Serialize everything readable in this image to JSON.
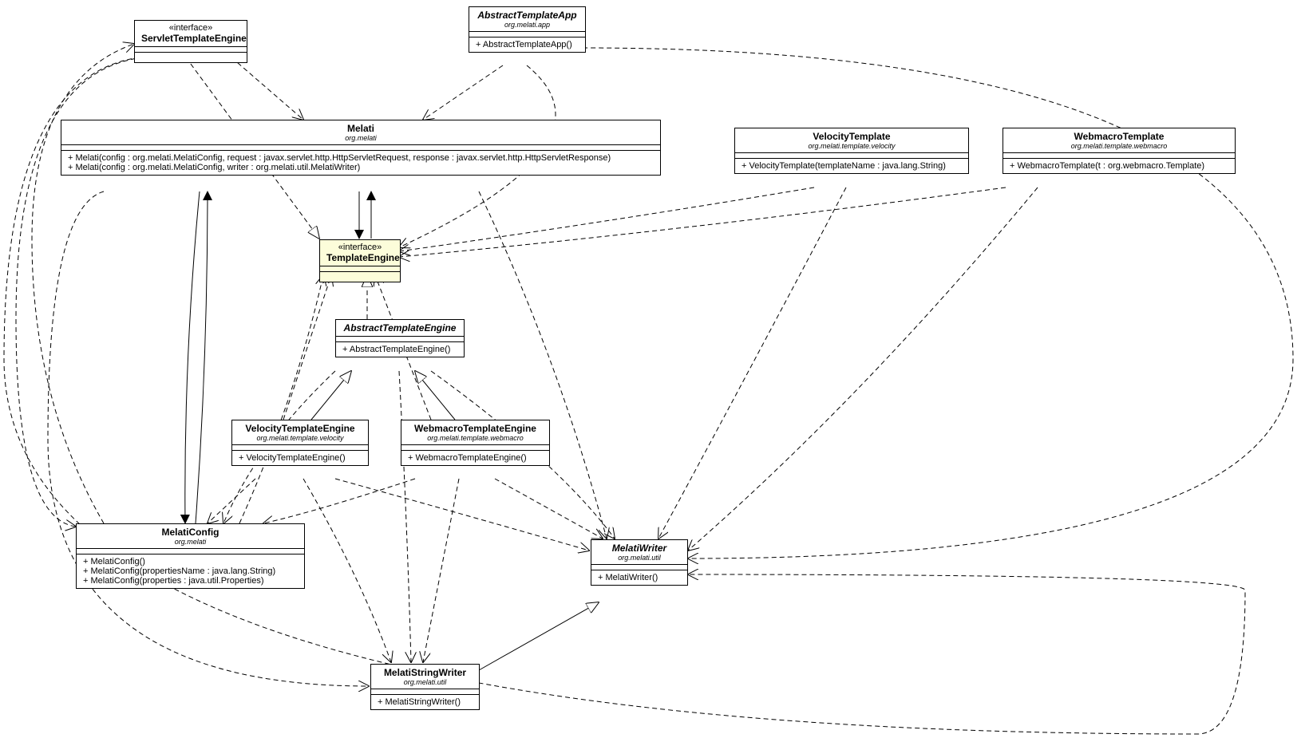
{
  "boxes": {
    "servletTemplateEngine": {
      "stereotype": "«interface»",
      "name": "ServletTemplateEngine"
    },
    "abstractTemplateApp": {
      "name": "AbstractTemplateApp",
      "pkg": "org.melati.app",
      "ops": [
        "+ AbstractTemplateApp()"
      ]
    },
    "melati": {
      "name": "Melati",
      "pkg": "org.melati",
      "ops": [
        "+ Melati(config : org.melati.MelatiConfig, request : javax.servlet.http.HttpServletRequest, response : javax.servlet.http.HttpServletResponse)",
        "+ Melati(config : org.melati.MelatiConfig, writer : org.melati.util.MelatiWriter)"
      ]
    },
    "velocityTemplate": {
      "name": "VelocityTemplate",
      "pkg": "org.melati.template.velocity",
      "ops": [
        "+ VelocityTemplate(templateName : java.lang.String)"
      ]
    },
    "webmacroTemplate": {
      "name": "WebmacroTemplate",
      "pkg": "org.melati.template.webmacro",
      "ops": [
        "+ WebmacroTemplate(t : org.webmacro.Template)"
      ]
    },
    "templateEngine": {
      "stereotype": "«interface»",
      "name": "TemplateEngine"
    },
    "abstractTemplateEngine": {
      "name": "AbstractTemplateEngine",
      "ops": [
        "+ AbstractTemplateEngine()"
      ]
    },
    "velocityTemplateEngine": {
      "name": "VelocityTemplateEngine",
      "pkg": "org.melati.template.velocity",
      "ops": [
        "+ VelocityTemplateEngine()"
      ]
    },
    "webmacroTemplateEngine": {
      "name": "WebmacroTemplateEngine",
      "pkg": "org.melati.template.webmacro",
      "ops": [
        "+ WebmacroTemplateEngine()"
      ]
    },
    "melatiConfig": {
      "name": "MelatiConfig",
      "pkg": "org.melati",
      "ops": [
        "+ MelatiConfig()",
        "+ MelatiConfig(propertiesName : java.lang.String)",
        "+ MelatiConfig(properties : java.util.Properties)"
      ]
    },
    "melatiWriter": {
      "name": "MelatiWriter",
      "pkg": "org.melati.util",
      "ops": [
        "+ MelatiWriter()"
      ]
    },
    "melatiStringWriter": {
      "name": "MelatiStringWriter",
      "pkg": "org.melati.util",
      "ops": [
        "+ MelatiStringWriter()"
      ]
    }
  },
  "chart_data": {
    "type": "uml-class-diagram",
    "classes": [
      {
        "id": "ServletTemplateEngine",
        "stereotype": "interface"
      },
      {
        "id": "AbstractTemplateApp",
        "package": "org.melati.app",
        "operations": [
          "AbstractTemplateApp()"
        ],
        "abstract": true
      },
      {
        "id": "Melati",
        "package": "org.melati",
        "operations": [
          "Melati(config:org.melati.MelatiConfig,request:javax.servlet.http.HttpServletRequest,response:javax.servlet.http.HttpServletResponse)",
          "Melati(config:org.melati.MelatiConfig,writer:org.melati.util.MelatiWriter)"
        ]
      },
      {
        "id": "VelocityTemplate",
        "package": "org.melati.template.velocity",
        "operations": [
          "VelocityTemplate(templateName:java.lang.String)"
        ]
      },
      {
        "id": "WebmacroTemplate",
        "package": "org.melati.template.webmacro",
        "operations": [
          "WebmacroTemplate(t:org.webmacro.Template)"
        ]
      },
      {
        "id": "TemplateEngine",
        "stereotype": "interface"
      },
      {
        "id": "AbstractTemplateEngine",
        "operations": [
          "AbstractTemplateEngine()"
        ],
        "abstract": true
      },
      {
        "id": "VelocityTemplateEngine",
        "package": "org.melati.template.velocity",
        "operations": [
          "VelocityTemplateEngine()"
        ]
      },
      {
        "id": "WebmacroTemplateEngine",
        "package": "org.melati.template.webmacro",
        "operations": [
          "WebmacroTemplateEngine()"
        ]
      },
      {
        "id": "MelatiConfig",
        "package": "org.melati",
        "operations": [
          "MelatiConfig()",
          "MelatiConfig(propertiesName:java.lang.String)",
          "MelatiConfig(properties:java.util.Properties)"
        ]
      },
      {
        "id": "MelatiWriter",
        "package": "org.melati.util",
        "operations": [
          "MelatiWriter()"
        ],
        "abstract": true
      },
      {
        "id": "MelatiStringWriter",
        "package": "org.melati.util",
        "operations": [
          "MelatiStringWriter()"
        ]
      }
    ],
    "relationships": [
      {
        "from": "ServletTemplateEngine",
        "to": "TemplateEngine",
        "type": "realization"
      },
      {
        "from": "AbstractTemplateEngine",
        "to": "TemplateEngine",
        "type": "realization"
      },
      {
        "from": "VelocityTemplateEngine",
        "to": "AbstractTemplateEngine",
        "type": "generalization"
      },
      {
        "from": "WebmacroTemplateEngine",
        "to": "AbstractTemplateEngine",
        "type": "generalization"
      },
      {
        "from": "MelatiStringWriter",
        "to": "MelatiWriter",
        "type": "generalization"
      },
      {
        "from": "AbstractTemplateApp",
        "to": "Melati",
        "type": "dependency"
      },
      {
        "from": "AbstractTemplateApp",
        "to": "TemplateEngine",
        "type": "dependency"
      },
      {
        "from": "AbstractTemplateApp",
        "to": "MelatiWriter",
        "type": "dependency"
      },
      {
        "from": "ServletTemplateEngine",
        "to": "Melati",
        "type": "dependency"
      },
      {
        "from": "ServletTemplateEngine",
        "to": "MelatiConfig",
        "type": "dependency"
      },
      {
        "from": "ServletTemplateEngine",
        "to": "MelatiWriter",
        "type": "dependency"
      },
      {
        "from": "Melati",
        "to": "MelatiConfig",
        "type": "association"
      },
      {
        "from": "MelatiConfig",
        "to": "Melati",
        "type": "association"
      },
      {
        "from": "Melati",
        "to": "TemplateEngine",
        "type": "association"
      },
      {
        "from": "Melati",
        "to": "MelatiWriter",
        "type": "dependency"
      },
      {
        "from": "Melati",
        "to": "MelatiStringWriter",
        "type": "dependency"
      },
      {
        "from": "MelatiConfig",
        "to": "TemplateEngine",
        "type": "dependency"
      },
      {
        "from": "MelatiConfig",
        "to": "ServletTemplateEngine",
        "type": "dependency"
      },
      {
        "from": "VelocityTemplate",
        "to": "TemplateEngine",
        "type": "dependency"
      },
      {
        "from": "VelocityTemplate",
        "to": "MelatiWriter",
        "type": "dependency"
      },
      {
        "from": "WebmacroTemplate",
        "to": "TemplateEngine",
        "type": "dependency"
      },
      {
        "from": "WebmacroTemplate",
        "to": "MelatiWriter",
        "type": "dependency"
      },
      {
        "from": "VelocityTemplateEngine",
        "to": "TemplateEngine",
        "type": "dependency"
      },
      {
        "from": "VelocityTemplateEngine",
        "to": "MelatiConfig",
        "type": "dependency"
      },
      {
        "from": "VelocityTemplateEngine",
        "to": "MelatiWriter",
        "type": "dependency"
      },
      {
        "from": "VelocityTemplateEngine",
        "to": "MelatiStringWriter",
        "type": "dependency"
      },
      {
        "from": "WebmacroTemplateEngine",
        "to": "TemplateEngine",
        "type": "dependency"
      },
      {
        "from": "WebmacroTemplateEngine",
        "to": "MelatiConfig",
        "type": "dependency"
      },
      {
        "from": "WebmacroTemplateEngine",
        "to": "MelatiWriter",
        "type": "dependency"
      },
      {
        "from": "WebmacroTemplateEngine",
        "to": "MelatiStringWriter",
        "type": "dependency"
      },
      {
        "from": "AbstractTemplateEngine",
        "to": "MelatiConfig",
        "type": "dependency"
      },
      {
        "from": "AbstractTemplateEngine",
        "to": "MelatiWriter",
        "type": "dependency"
      },
      {
        "from": "AbstractTemplateEngine",
        "to": "MelatiStringWriter",
        "type": "dependency"
      }
    ]
  }
}
